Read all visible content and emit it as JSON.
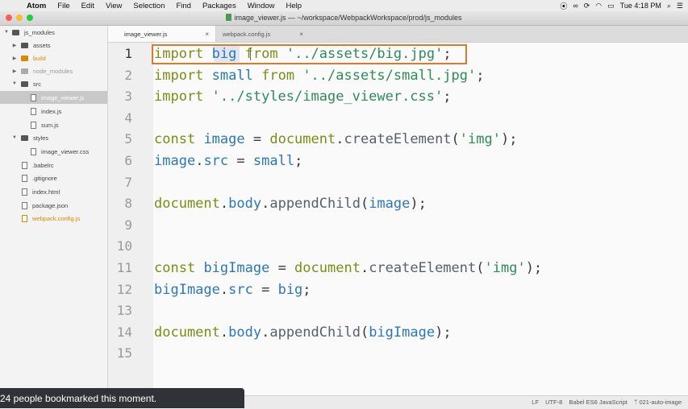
{
  "menubar": {
    "app": "Atom",
    "items": [
      "File",
      "Edit",
      "View",
      "Selection",
      "Find",
      "Packages",
      "Window",
      "Help"
    ],
    "clock": "Tue 4:18 PM"
  },
  "window": {
    "title": "image_viewer.js — ~/workspace/WebpackWorkspace/prod/js_modules"
  },
  "tree": {
    "root": "js_modules",
    "items": [
      {
        "label": "assets"
      },
      {
        "label": "build"
      },
      {
        "label": "node_modules"
      },
      {
        "label": "src"
      },
      {
        "label": "image_viewer.js"
      },
      {
        "label": "index.js"
      },
      {
        "label": "sum.js"
      },
      {
        "label": "styles"
      },
      {
        "label": "image_viewer.css"
      },
      {
        "label": ".babelrc"
      },
      {
        "label": ".gitignore"
      },
      {
        "label": "index.html"
      },
      {
        "label": "package.json"
      },
      {
        "label": "webpack.config.js"
      }
    ]
  },
  "tabs": [
    {
      "label": "image_viewer.js",
      "close": "×"
    },
    {
      "label": "webpack.config.js",
      "close": "×"
    }
  ],
  "editor": {
    "line_numbers": [
      "1",
      "2",
      "3",
      "4",
      "5",
      "6",
      "7",
      "8",
      "9",
      "10",
      "11",
      "12",
      "13",
      "14",
      "15"
    ],
    "current_line": 1
  },
  "status": {
    "line_ending": "LF",
    "encoding": "UTF-8",
    "grammar": "Babel ES6 JavaScript",
    "branch": "021-auto-image"
  },
  "toast": {
    "text": "24 people bookmarked this moment."
  },
  "colors": {
    "highlight_box": "#d97b2b",
    "keyword": "#7d8c15",
    "string": "#2e8b5a",
    "identifier": "#2c78b4"
  }
}
